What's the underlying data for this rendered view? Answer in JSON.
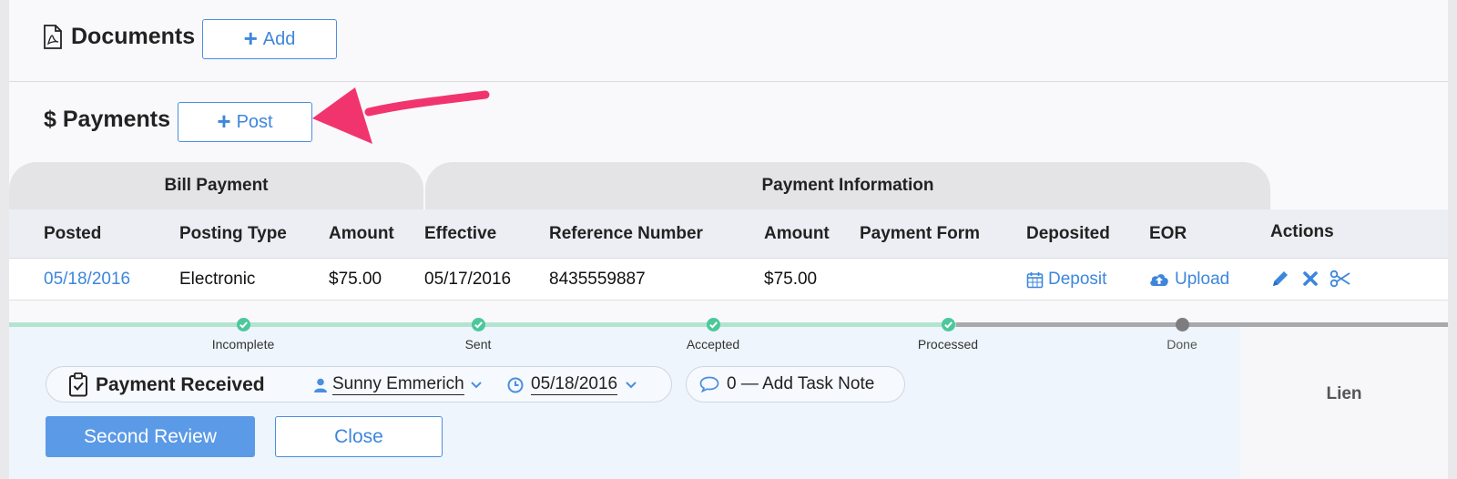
{
  "documents": {
    "title": "Documents",
    "add_label": "Add"
  },
  "payments": {
    "title": "Payments",
    "dollar": "$",
    "post_label": "Post"
  },
  "groups": {
    "bill_payment": "Bill Payment",
    "payment_information": "Payment Information"
  },
  "columns": {
    "posted": "Posted",
    "posting_type": "Posting Type",
    "amount": "Amount",
    "effective": "Effective",
    "reference_number": "Reference Number",
    "amount2": "Amount",
    "payment_form": "Payment Form",
    "deposited": "Deposited",
    "eor": "EOR",
    "actions": "Actions"
  },
  "row": {
    "posted": "05/18/2016",
    "posting_type": "Electronic",
    "amount": "$75.00",
    "effective": "05/17/2016",
    "reference_number": "8435559887",
    "amount2": "$75.00",
    "payment_form": "",
    "deposited": "Deposit",
    "eor": "Upload"
  },
  "workflow": {
    "steps": [
      {
        "label": "Incomplete",
        "done": true
      },
      {
        "label": "Sent",
        "done": true
      },
      {
        "label": "Accepted",
        "done": true
      },
      {
        "label": "Processed",
        "done": true
      },
      {
        "label": "Done",
        "done": false
      }
    ],
    "task_title": "Payment Received",
    "assignee": "Sunny Emmerich",
    "due_date": "05/18/2016",
    "note_label": "0 — Add Task Note",
    "primary_button": "Second Review",
    "close_button": "Close",
    "side_label": "Lien"
  },
  "colors": {
    "accent": "#3d86dc",
    "success": "#4cc89a",
    "pending": "#8a8a8a",
    "annotation_arrow": "#f2346e"
  },
  "icons": [
    "pdf-file-icon",
    "plus-icon",
    "calendar-icon",
    "cloud-upload-icon",
    "pencil-icon",
    "close-x-icon",
    "scissors-icon",
    "clipboard-check-icon",
    "user-icon",
    "clock-icon",
    "chevron-down-icon",
    "speech-bubble-icon",
    "check-icon"
  ]
}
